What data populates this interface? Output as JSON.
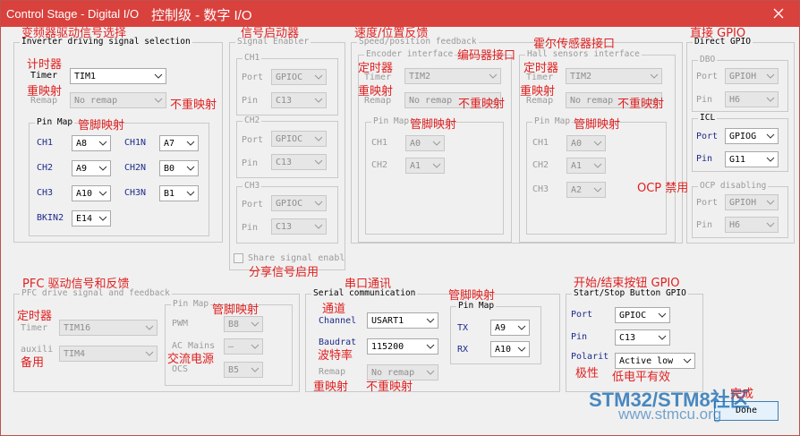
{
  "window": {
    "title": "Control Stage - Digital I/O",
    "title_zh": "控制级 - 数字 I/O"
  },
  "inverter": {
    "title": "Inverter driving signal selection",
    "ann_title": "变频器驱动信号选择",
    "timer_label": "Timer",
    "timer_value": "TIM1",
    "ann_timer": "计时器",
    "remap_label": "Remap",
    "remap_value": "No remap",
    "ann_remap": "重映射",
    "ann_noremap": "不重映射",
    "pinmap_title": "Pin Map",
    "ann_pinmap": "管脚映射",
    "pins": [
      {
        "label": "CH1",
        "value": "A8"
      },
      {
        "label": "CH1N",
        "value": "A7"
      },
      {
        "label": "CH2",
        "value": "A9"
      },
      {
        "label": "CH2N",
        "value": "B0"
      },
      {
        "label": "CH3",
        "value": "A10"
      },
      {
        "label": "CH3N",
        "value": "B1"
      },
      {
        "label": "BKIN2",
        "value": "E14"
      }
    ]
  },
  "signal_enabler": {
    "title": "Signal Enabler",
    "ann_title": "信号启动器",
    "channels": [
      {
        "title": "CH1",
        "port_label": "Port",
        "port_value": "GPIOC",
        "pin_label": "Pin",
        "pin_value": "C13"
      },
      {
        "title": "CH2",
        "port_label": "Port",
        "port_value": "GPIOC",
        "pin_label": "Pin",
        "pin_value": "C13"
      },
      {
        "title": "CH3",
        "port_label": "Port",
        "port_value": "GPIOC",
        "pin_label": "Pin",
        "pin_value": "C13"
      }
    ],
    "share_label": "Share signal enabl",
    "ann_share": "分享信号启用"
  },
  "encoder": {
    "title": "Encoder interface",
    "section_title": "Speed/position feedback",
    "ann_section": "速度/位置反馈",
    "ann_title": "编码器接口",
    "timer_label": "Timer",
    "timer_value": "TIM2",
    "ann_timer": "定时器",
    "remap_label": "Remap",
    "remap_value": "No remap",
    "ann_remap": "重映射",
    "ann_noremap": "不重映射",
    "pinmap_title": "Pin Map",
    "ann_pinmap": "管脚映射",
    "pins": [
      {
        "label": "CH1",
        "value": "A0"
      },
      {
        "label": "CH2",
        "value": "A1"
      }
    ]
  },
  "hall": {
    "title": "Hall sensors interface",
    "ann_title": "霍尔传感器接口",
    "timer_label": "Timer",
    "timer_value": "TIM2",
    "ann_timer": "定时器",
    "remap_label": "Remap",
    "remap_value": "No remap",
    "ann_remap": "重映射",
    "ann_noremap": "不重映射",
    "pinmap_title": "Pin Map",
    "ann_pinmap": "管脚映射",
    "pins": [
      {
        "label": "CH1",
        "value": "A0"
      },
      {
        "label": "CH2",
        "value": "A1"
      },
      {
        "label": "CH3",
        "value": "A2"
      }
    ]
  },
  "direct_gpio": {
    "title": "Direct GPIO",
    "ann_title": "直接 GPIO",
    "dbo": {
      "title": "DBO",
      "port_label": "Port",
      "port_value": "GPIOH",
      "pin_label": "Pin",
      "pin_value": "H6"
    },
    "icl": {
      "title": "ICL",
      "port_label": "Port",
      "port_value": "GPIOG",
      "pin_label": "Pin",
      "pin_value": "G11"
    },
    "ocp": {
      "title": "OCP disabling",
      "ann_title": "OCP 禁用",
      "port_label": "Port",
      "port_value": "GPIOH",
      "pin_label": "Pin",
      "pin_value": "H6"
    }
  },
  "pfc": {
    "title": "PFC drive signal and feedback",
    "ann_title": "PFC 驱动信号和反馈",
    "timer_label": "Timer",
    "timer_value": "TIM16",
    "ann_timer": "定时器",
    "aux_label": "auxili",
    "aux_value": "TIM4",
    "ann_aux": "备用",
    "pinmap_title": "Pin Map",
    "ann_pinmap": "管脚映射",
    "pwm_label": "PWM",
    "pwm_value": "B8",
    "ac_label": "AC Mains",
    "ac_value": "—",
    "ann_ac": "交流电源",
    "ocs_label": "OCS",
    "ocs_value": "B5"
  },
  "serial": {
    "title": "Serial communication",
    "ann_title": "串口通讯",
    "channel_label": "Channel",
    "channel_value": "USART1",
    "ann_channel": "通道",
    "baud_label": "Baudrat",
    "baud_value": "115200",
    "ann_baud": "波特率",
    "remap_label": "Remap",
    "remap_value": "No remap",
    "ann_remap": "重映射",
    "ann_noremap": "不重映射",
    "pinmap_title": "Pin Map",
    "ann_pinmap": "管脚映射",
    "tx_label": "TX",
    "tx_value": "A9",
    "rx_label": "RX",
    "rx_value": "A10"
  },
  "startstop": {
    "title": "Start/Stop Button GPIO",
    "ann_title": "开始/结束按钮 GPIO",
    "port_label": "Port",
    "port_value": "GPIOC",
    "pin_label": "Pin",
    "pin_value": "C13",
    "polarity_label": "Polarit",
    "polarity_value": "Active low",
    "ann_polarity": "极性",
    "ann_active": "低电平有效"
  },
  "done": {
    "label": "Done",
    "ann": "完成"
  },
  "watermark": {
    "text1": "STM32/STM8社区",
    "text2": "www.stmcu.org"
  },
  "colors": {
    "title_bar": "#d9413d",
    "annotation": "#e02020",
    "label_blue": "#1d2a8c",
    "watermark": "#1f6fb5"
  }
}
